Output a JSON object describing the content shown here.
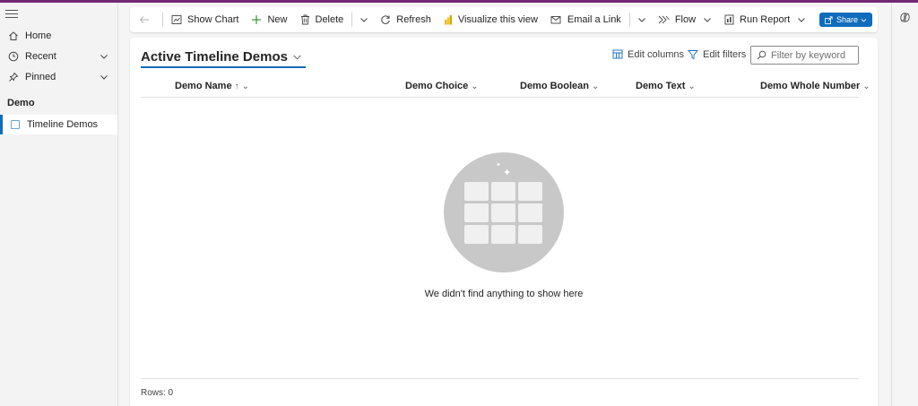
{
  "sidebar": {
    "items": [
      {
        "label": "Home",
        "icon": "home-icon"
      },
      {
        "label": "Recent",
        "icon": "clock-icon"
      },
      {
        "label": "Pinned",
        "icon": "pin-icon"
      }
    ],
    "group_title": "Demo",
    "entity": {
      "label": "Timeline Demos",
      "icon": "entity-icon"
    }
  },
  "toolbar": {
    "show_chart": "Show Chart",
    "new": "New",
    "delete": "Delete",
    "refresh": "Refresh",
    "visualize": "Visualize this view",
    "email_link": "Email a Link",
    "flow": "Flow",
    "run_report": "Run Report",
    "share": "Share"
  },
  "view": {
    "title": "Active Timeline Demos",
    "edit_columns": "Edit columns",
    "edit_filters": "Edit filters",
    "filter_placeholder": "Filter by keyword",
    "columns": [
      {
        "label": "Demo Name",
        "sort": "↑"
      },
      {
        "label": "Demo Choice"
      },
      {
        "label": "Demo Boolean"
      },
      {
        "label": "Demo Text"
      },
      {
        "label": "Demo Whole Number"
      }
    ],
    "empty_message": "We didn't find anything to show here",
    "rows_label": "Rows: 0"
  },
  "colors": {
    "accent": "#0f6cbd",
    "top_bar": "#742774",
    "empty_circle": "#c8c8c8"
  }
}
